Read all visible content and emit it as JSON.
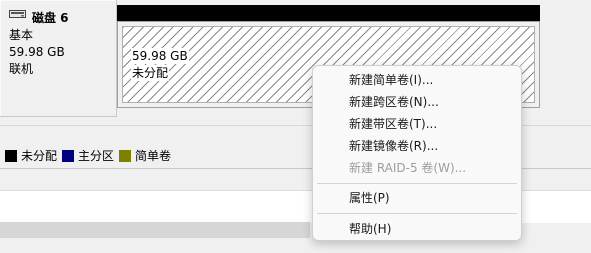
{
  "disk": {
    "name": "磁盘 6",
    "type": "基本",
    "size": "59.98 GB",
    "status": "联机",
    "icon": "disk-icon"
  },
  "partition": {
    "size": "59.98 GB",
    "state": "未分配"
  },
  "legend": [
    {
      "label": "未分配",
      "color": "#000000"
    },
    {
      "label": "主分区",
      "color": "#000080"
    },
    {
      "label": "简单卷",
      "color": "#808000"
    }
  ],
  "context_menu": {
    "items": [
      {
        "label": "新建简单卷(I)...",
        "enabled": true
      },
      {
        "label": "新建跨区卷(N)...",
        "enabled": true
      },
      {
        "label": "新建带区卷(T)...",
        "enabled": true
      },
      {
        "label": "新建镜像卷(R)...",
        "enabled": true
      },
      {
        "label": "新建 RAID-5 卷(W)...",
        "enabled": false
      },
      {
        "label": "属性(P)",
        "enabled": true
      },
      {
        "label": "帮助(H)",
        "enabled": true
      }
    ]
  }
}
